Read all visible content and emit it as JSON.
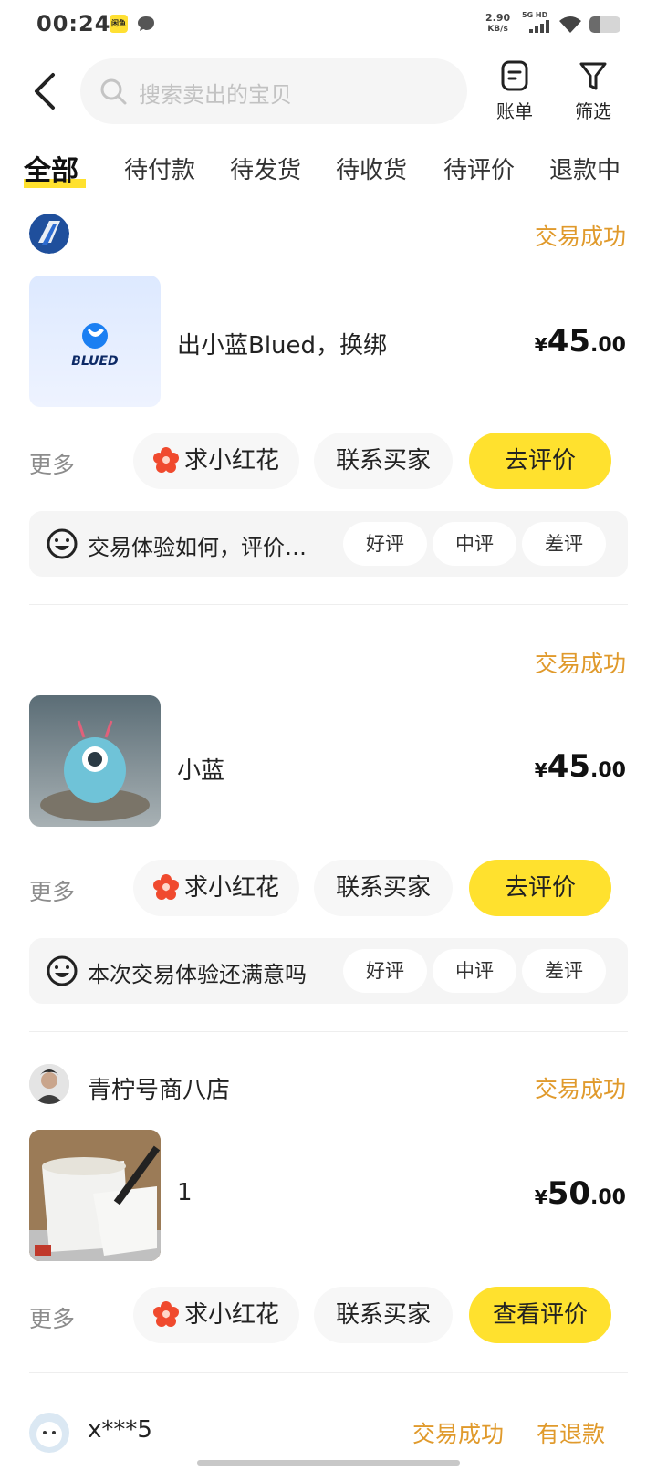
{
  "status_bar": {
    "time": "00:24",
    "app_badge": "闲鱼",
    "speed_value": "2.90",
    "speed_unit": "KB/s",
    "network": "5G HD",
    "battery_level": 0.35
  },
  "header": {
    "search_placeholder": "搜索卖出的宝贝",
    "bill_label": "账单",
    "filter_label": "筛选"
  },
  "tabs": [
    {
      "label": "全部",
      "active": true
    },
    {
      "label": "待付款",
      "active": false
    },
    {
      "label": "待发货",
      "active": false
    },
    {
      "label": "待收货",
      "active": false
    },
    {
      "label": "待评价",
      "active": false
    },
    {
      "label": "退款中",
      "active": false
    }
  ],
  "orders": [
    {
      "seller_name": "",
      "status": "交易成功",
      "product_title": "出小蓝Blued，换绑",
      "thumb_text": "BLUED",
      "price_currency": "¥",
      "price_int": "45",
      "price_dec": ".00",
      "more_label": "更多",
      "flower_label": "求小红花",
      "contact_label": "联系买家",
      "primary_label": "去评价",
      "rating_prompt": "交易体验如何，评价…",
      "rating_options": [
        "好评",
        "中评",
        "差评"
      ]
    },
    {
      "seller_name": "",
      "status": "交易成功",
      "product_title": "小蓝",
      "price_currency": "¥",
      "price_int": "45",
      "price_dec": ".00",
      "more_label": "更多",
      "flower_label": "求小红花",
      "contact_label": "联系买家",
      "primary_label": "去评价",
      "rating_prompt": "本次交易体验还满意吗",
      "rating_options": [
        "好评",
        "中评",
        "差评"
      ]
    },
    {
      "seller_name": "青柠号商八店",
      "status": "交易成功",
      "product_title": "1",
      "price_currency": "¥",
      "price_int": "50",
      "price_dec": ".00",
      "more_label": "更多",
      "flower_label": "求小红花",
      "contact_label": "联系买家",
      "primary_label": "查看评价"
    },
    {
      "seller_name": "x***5",
      "status": "交易成功",
      "status_secondary": "有退款"
    }
  ],
  "colors": {
    "accent_yellow": "#ffe12e",
    "status_orange": "#e09a2c",
    "flower_red": "#f04a2e"
  }
}
